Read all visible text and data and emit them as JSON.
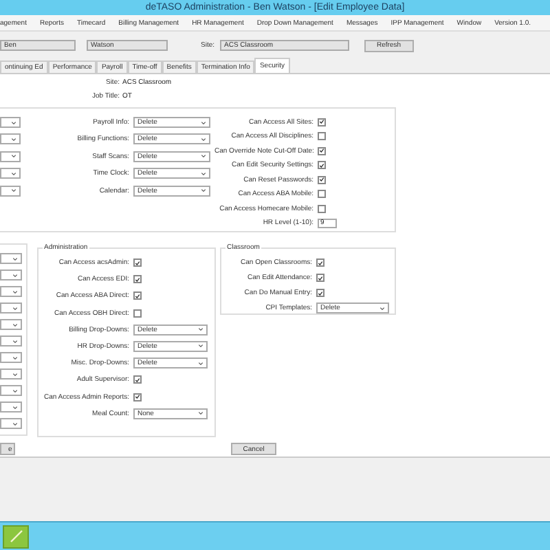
{
  "window": {
    "title": "deTASO Administration - Ben Watson - [Edit Employee Data]"
  },
  "menu": [
    "agement",
    "Reports",
    "Timecard",
    "Billing Management",
    "HR Management",
    "Drop Down Management",
    "Messages",
    "IPP Management",
    "Window",
    "Version 1.0."
  ],
  "header": {
    "first_name": "Ben",
    "last_name": "Watson",
    "site_label": "Site:",
    "site": "ACS Classroom",
    "refresh": "Refresh"
  },
  "tabs": [
    {
      "label": "ontinuing Ed",
      "selected": false
    },
    {
      "label": "Performance",
      "selected": false
    },
    {
      "label": "Payroll",
      "selected": false
    },
    {
      "label": "Time-off",
      "selected": false
    },
    {
      "label": "Benefits",
      "selected": false
    },
    {
      "label": "Termination Info",
      "selected": false
    },
    {
      "label": "Security",
      "selected": true
    }
  ],
  "info": [
    {
      "label": "Site:",
      "value": "ACS Classroom"
    },
    {
      "label": "Job Title:",
      "value": "OT"
    }
  ],
  "top_group": {
    "middle": [
      {
        "kind": "dropdown",
        "label": "Payroll Info:",
        "value": "Delete"
      },
      {
        "kind": "dropdown",
        "label": "Billing Functions:",
        "value": "Delete"
      },
      {
        "kind": "dropdown",
        "label": "Staff Scans:",
        "value": "Delete"
      },
      {
        "kind": "dropdown",
        "label": "Time Clock:",
        "value": "Delete"
      },
      {
        "kind": "dropdown",
        "label": "Calendar:",
        "value": "Delete"
      }
    ],
    "right": [
      {
        "kind": "checkbox",
        "label": "Can Access All Sites:",
        "checked": true
      },
      {
        "kind": "checkbox",
        "label": "Can Access All Disciplines:",
        "checked": false
      },
      {
        "kind": "checkbox",
        "label": "Can Override Note Cut-Off Date:",
        "checked": true
      },
      {
        "kind": "checkbox",
        "label": "Can Edit Security Settings:",
        "checked": true
      },
      {
        "kind": "checkbox",
        "label": "Can Reset Passwords:",
        "checked": true
      },
      {
        "kind": "checkbox",
        "label": "Can Access ABA Mobile:",
        "checked": false
      },
      {
        "kind": "checkbox",
        "label": "Can Access Homecare Mobile:",
        "checked": false
      },
      {
        "kind": "text",
        "label": "HR Level (1-10):",
        "value": "9"
      }
    ]
  },
  "administration": {
    "title": "Administration",
    "rows": [
      {
        "kind": "checkbox",
        "label": "Can Access acsAdmin:",
        "checked": true
      },
      {
        "kind": "checkbox",
        "label": "Can Access EDI:",
        "checked": true
      },
      {
        "kind": "checkbox",
        "label": "Can Access ABA Direct:",
        "checked": true
      },
      {
        "kind": "checkbox",
        "label": "Can Access OBH Direct:",
        "checked": false
      },
      {
        "kind": "dropdown",
        "label": "Billing Drop-Downs:",
        "value": "Delete"
      },
      {
        "kind": "dropdown",
        "label": "HR Drop-Downs:",
        "value": "Delete"
      },
      {
        "kind": "dropdown",
        "label": "Misc. Drop-Downs:",
        "value": "Delete"
      },
      {
        "kind": "checkbox",
        "label": "Adult Supervisor:",
        "checked": true
      },
      {
        "kind": "checkbox",
        "label": "Can Access Admin Reports:",
        "checked": true
      },
      {
        "kind": "dropdown",
        "label": "Meal Count:",
        "value": "None"
      }
    ]
  },
  "classroom": {
    "title": "Classroom",
    "rows": [
      {
        "kind": "checkbox",
        "label": "Can Open Classrooms:",
        "checked": true
      },
      {
        "kind": "checkbox",
        "label": "Can Edit Attendance:",
        "checked": true
      },
      {
        "kind": "checkbox",
        "label": "Can Do Manual Entry:",
        "checked": true
      },
      {
        "kind": "dropdown",
        "label": "CPI Templates:",
        "value": "Delete"
      }
    ]
  },
  "buttons": [
    "e",
    "Cancel"
  ]
}
